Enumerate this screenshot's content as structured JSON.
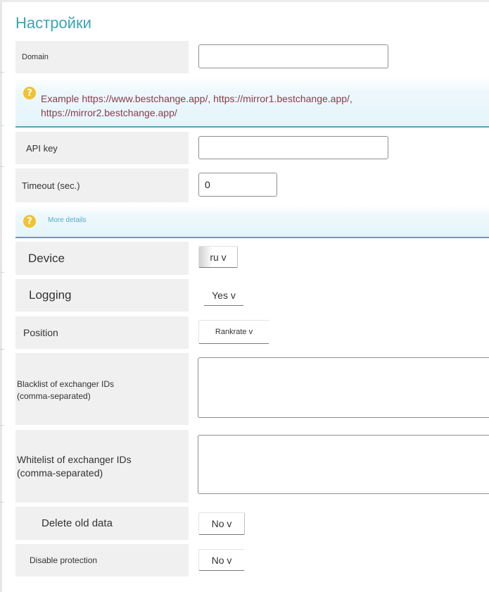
{
  "page": {
    "title": "Настройки"
  },
  "domain": {
    "label": "Domain",
    "value": "",
    "placeholder": ""
  },
  "hint_domain": {
    "text": "Example https://www.bestchange.app/, https://mirror1.bestchange.app/, https://mirror2.bestchange.app/"
  },
  "api_key": {
    "label": "API key",
    "value": ""
  },
  "timeout": {
    "label": "Timeout (sec.)",
    "value": "0"
  },
  "hint_more": {
    "link": "More details"
  },
  "device": {
    "label": "Device",
    "selected": "ru v"
  },
  "logging": {
    "label": "Logging",
    "selected": "Yes v"
  },
  "position": {
    "label": "Position",
    "selected": "Rankrate v"
  },
  "blacklist": {
    "label_line1": "Blacklist of exchanger IDs",
    "label_line2": "(comma-separated)",
    "value": ""
  },
  "whitelist": {
    "label_line1": "Whitelist of exchanger IDs",
    "label_line2": "(comma-separated)",
    "value": ""
  },
  "delete_old": {
    "label": "Delete old data",
    "selected": "No v"
  },
  "disable_protection": {
    "label": "Disable protection",
    "selected": "No v"
  },
  "icons": {
    "help": "question-mark-icon"
  },
  "colors": {
    "title": "#3aa5b5",
    "hint_text": "#8b3a4a",
    "link": "#5aa8c7",
    "help_icon": "#f1c232",
    "row_label_bg": "#f0f0f0"
  }
}
